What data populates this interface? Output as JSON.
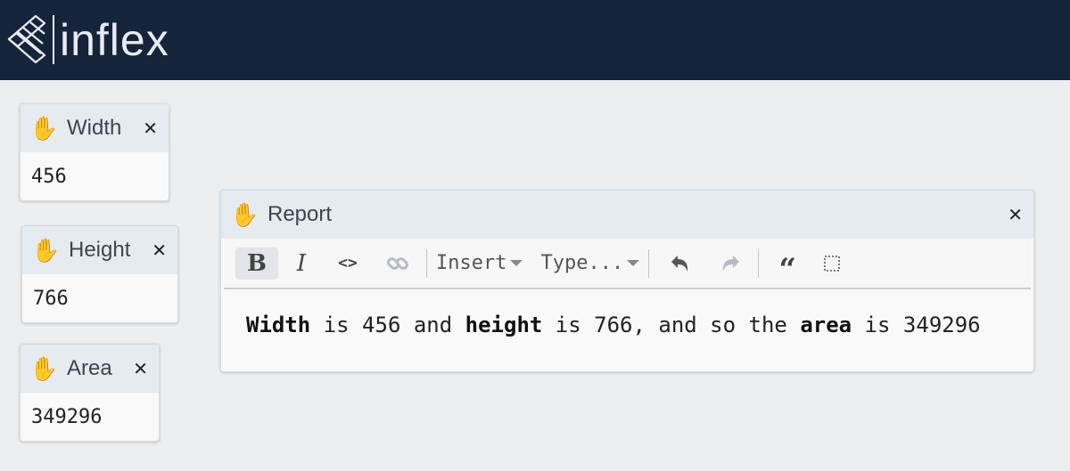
{
  "app": {
    "logo_text": "inflex"
  },
  "cells": {
    "width": {
      "title": "Width",
      "value": "456",
      "icon": "raised-hand-icon"
    },
    "height": {
      "title": "Height",
      "value": "766",
      "icon": "raised-hand-icon"
    },
    "area": {
      "title": "Area",
      "value": "349296",
      "icon": "raised-hand-icon"
    }
  },
  "report": {
    "title": "Report",
    "icon": "raised-hand-icon",
    "toolbar": {
      "bold": "B",
      "italic": "I",
      "code": "<>",
      "insert_label": "Insert",
      "type_label": "Type...",
      "quote": "“"
    },
    "content": {
      "w_word": "Width",
      "t1": " is 456 and ",
      "h_word": "height",
      "t2": " is 766, and so the ",
      "a_word": "area",
      "t3": " is 349296"
    }
  },
  "colors": {
    "header_bg": "#16243b",
    "page_bg": "#eceeef",
    "cell_head_bg": "#e6ebf0",
    "hand": "#f5b918"
  }
}
